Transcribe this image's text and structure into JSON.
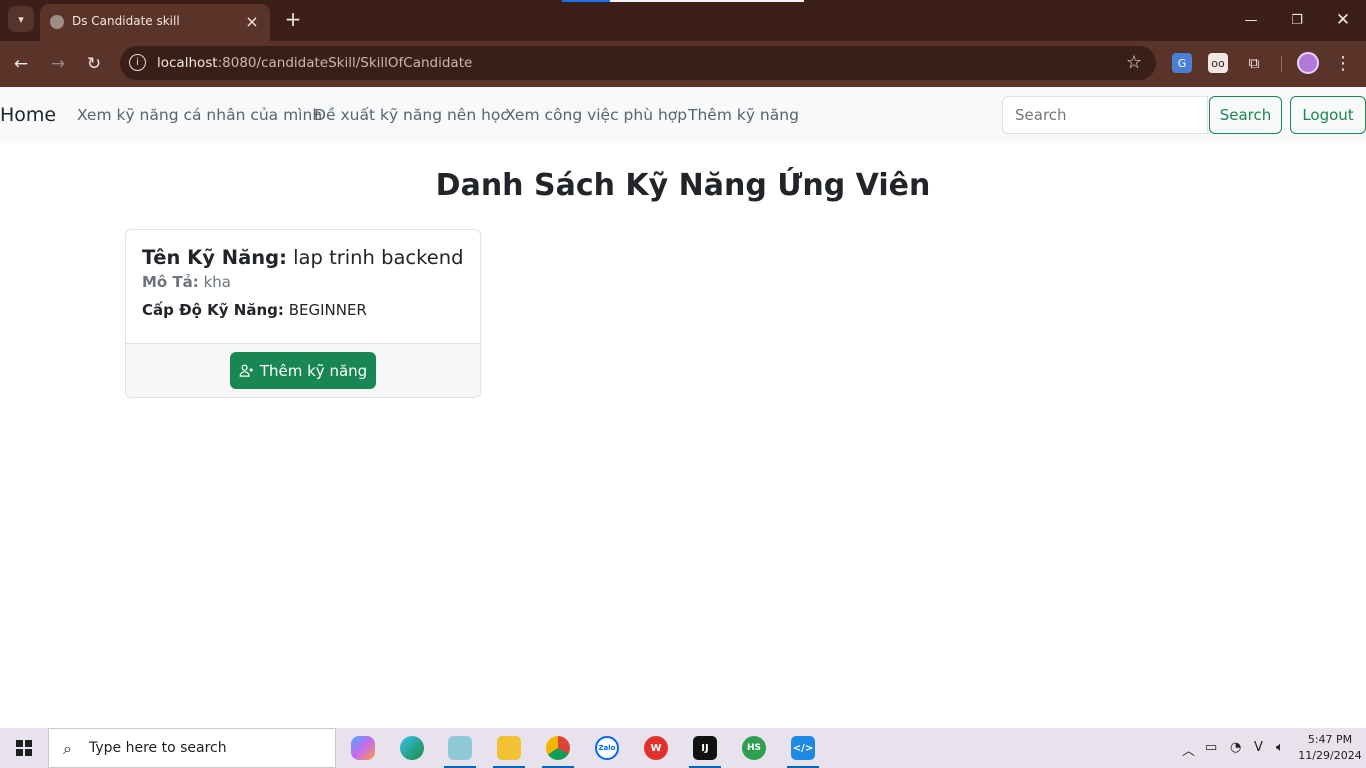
{
  "browser": {
    "tab_title": "Ds Candidate skill",
    "url_host": "localhost",
    "url_path": ":8080/candidateSkill/SkillOfCandidate"
  },
  "navbar": {
    "brand": "Home",
    "links": [
      "Xem kỹ năng cá nhân của mình",
      "Đề xuất kỹ năng nên học",
      "Xem công việc phù hợp",
      "Thêm kỹ năng"
    ],
    "search_placeholder": "Search",
    "search_button": "Search",
    "logout_button": "Logout"
  },
  "page": {
    "title": "Danh Sách Kỹ Năng Ứng Viên"
  },
  "skill_card": {
    "name_label": "Tên Kỹ Năng:",
    "name_value": "lap trinh backend",
    "desc_label": "Mô Tả:",
    "desc_value": "kha",
    "level_label": "Cấp Độ Kỹ Năng:",
    "level_value": "BEGINNER",
    "add_button": "Thêm kỹ năng"
  },
  "taskbar": {
    "search_placeholder": "Type here to search",
    "time": "5:47 PM",
    "date": "11/29/2024"
  },
  "colors": {
    "success": "#198754",
    "navbar_bg": "#f8f9fa",
    "chrome_dark": "#3b1f18",
    "chrome_mid": "#5a3428"
  }
}
